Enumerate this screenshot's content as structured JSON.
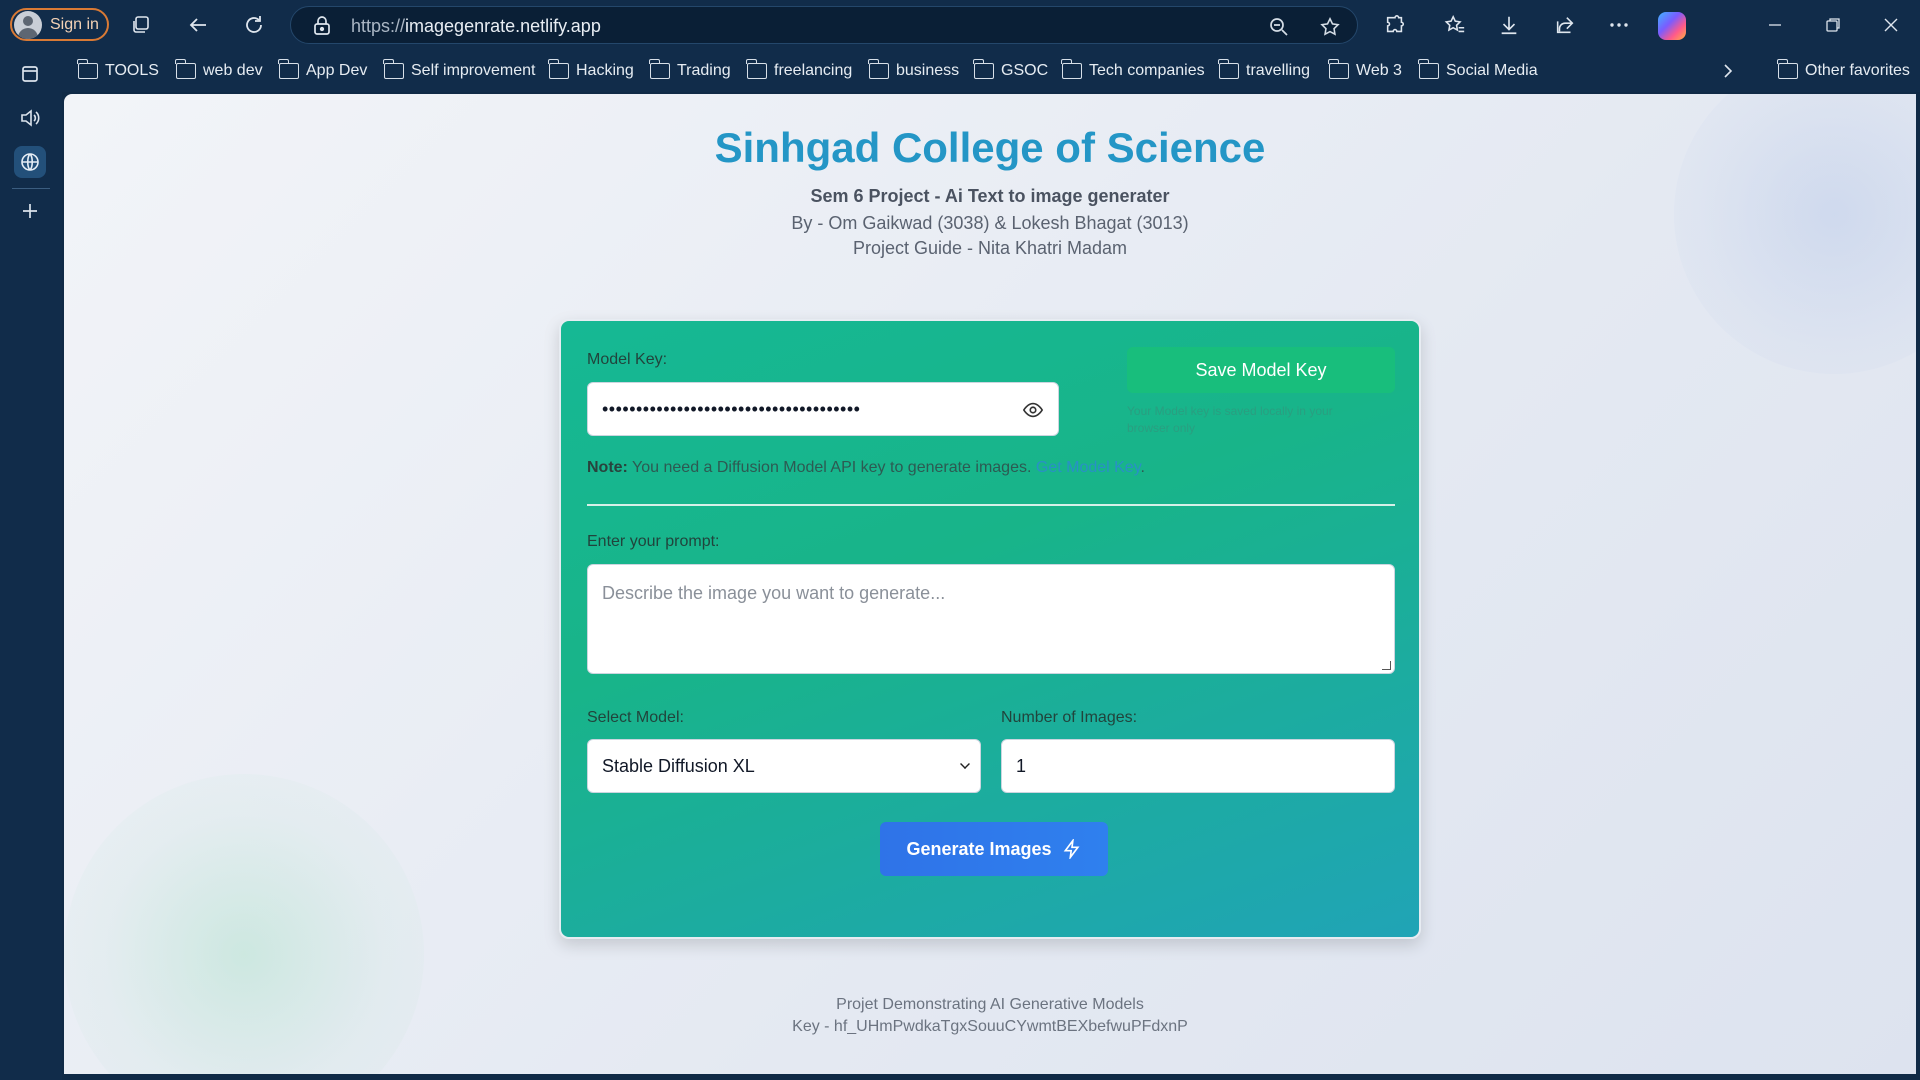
{
  "browser": {
    "signin_label": "Sign in",
    "url_protocol": "https://",
    "url_host": "imagegenrate.netlify.app",
    "icons": [
      "tabs-icon",
      "back-icon",
      "refresh-icon",
      "lock-icon",
      "zoom-out-icon",
      "star-icon",
      "extensions-icon",
      "favorites-icon",
      "download-icon",
      "share-icon",
      "more-icon",
      "copilot-icon",
      "minimize-icon",
      "restore-icon",
      "close-icon"
    ]
  },
  "bookmarks": {
    "items": [
      "TOOLS",
      "web dev",
      "App Dev",
      "Self improvement",
      "Hacking",
      "Trading",
      "freelancing",
      "business",
      "GSOC",
      "Tech companies",
      "travelling",
      "Web 3",
      "Social Media"
    ],
    "other": "Other favorites"
  },
  "header": {
    "title": "Sinhgad College of Science",
    "subtitle": "Sem 6 Project - Ai Text to image generater",
    "authors": "By - Om Gaikwad (3038) & Lokesh Bhagat (3013)",
    "guide": "Project Guide - Nita Khatri Madam"
  },
  "form": {
    "model_key_label": "Model Key:",
    "model_key_value": "••••••••••••••••••••••••••••••••••••••",
    "save_button": "Save Model Key",
    "save_note": "Your Model key is saved locally in your browser only",
    "note_prefix": "Note:",
    "note_text": " You need a Diffusion Model API key to generate images. ",
    "note_link": "Get Model Key",
    "note_suffix": ".",
    "prompt_label": "Enter your prompt:",
    "prompt_placeholder": "Describe the image you want to generate...",
    "model_label": "Select Model:",
    "model_selected": "Stable Diffusion XL",
    "count_label": "Number of Images:",
    "count_value": "1",
    "generate_button": "Generate Images"
  },
  "footer": {
    "line1": "Projet Demonstrating AI Generative Models",
    "line2": "Key - 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"
  }
}
